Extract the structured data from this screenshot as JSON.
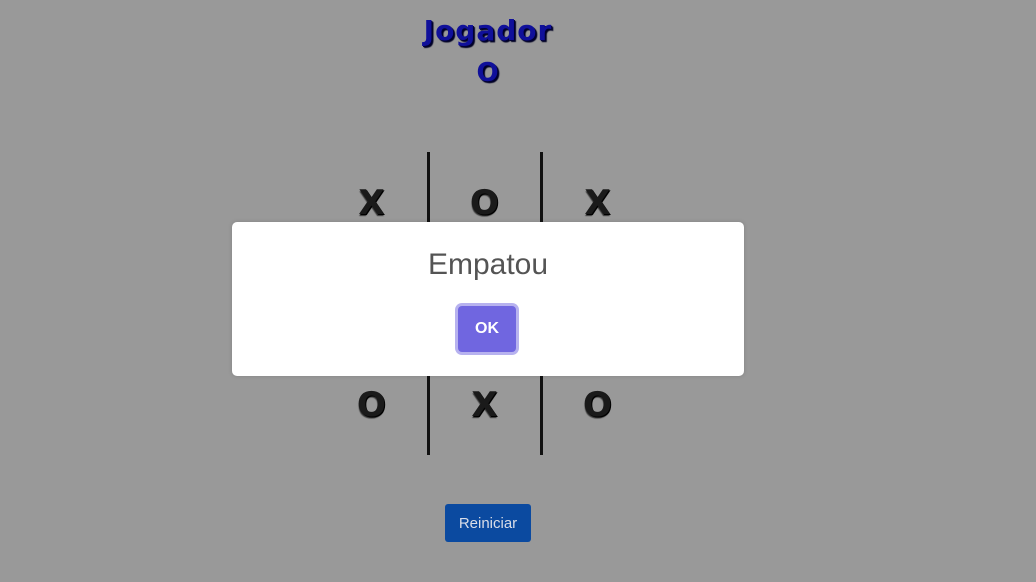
{
  "header": {
    "title_line1": "Jogador",
    "title_line2": "O",
    "title_color": "#10109a"
  },
  "board": {
    "cells": [
      [
        "X",
        "O",
        "X"
      ],
      [
        "",
        "",
        ""
      ],
      [
        "O",
        "X",
        "O"
      ]
    ]
  },
  "dialog": {
    "message": "Empatou",
    "ok_label": "OK",
    "ok_color": "#7066e0"
  },
  "controls": {
    "restart_label": "Reiniciar",
    "restart_color": "#0b4aa0"
  },
  "background_color": "#999999"
}
